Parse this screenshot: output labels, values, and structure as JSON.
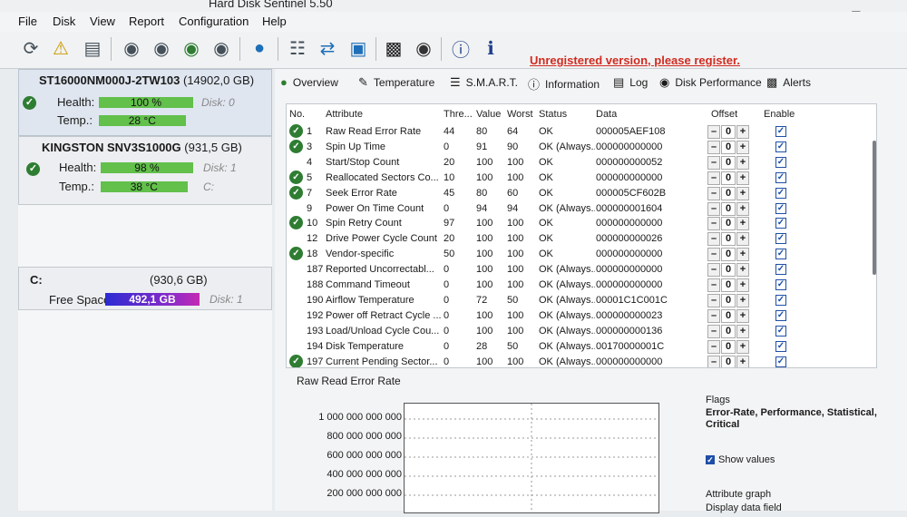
{
  "title": "Hard Disk Sentinel 5.50",
  "menu": [
    "File",
    "Disk",
    "View",
    "Report",
    "Configuration",
    "Help"
  ],
  "unregistered": "Unregistered version, please register.",
  "disks": [
    {
      "name": "ST16000NM000J-2TW103",
      "capacity": "(14902,0 GB)",
      "health_label": "Health:",
      "health": "100 %",
      "health_pct": 100,
      "disk_label": "Disk: 0",
      "temp_label": "Temp.:",
      "temp": "28 °C",
      "temp_pct": 92
    },
    {
      "name": "KINGSTON SNV3S1000G",
      "capacity": "(931,5 GB)",
      "health_label": "Health:",
      "health": "98 %",
      "health_pct": 98,
      "disk_label": "Disk: 1",
      "temp_label": "Temp.:",
      "temp": "38 °C",
      "temp_pct": 92,
      "temp_sub": "C:"
    }
  ],
  "volume": {
    "name": "C:",
    "size": "(930,6 GB)",
    "free_label": "Free Space",
    "free": "492,1 GB",
    "disk": "Disk: 1"
  },
  "tabs": [
    "Overview",
    "Temperature",
    "S.M.A.R.T.",
    "Information",
    "Log",
    "Disk Performance",
    "Alerts"
  ],
  "columns": {
    "no": "No.",
    "attribute": "Attribute",
    "thre": "Thre...",
    "value": "Value",
    "worst": "Worst",
    "status": "Status",
    "data": "Data",
    "offset": "Offset",
    "enable": "Enable"
  },
  "rows": [
    {
      "ok": true,
      "no": "1",
      "attr": "Raw Read Error Rate",
      "thre": "44",
      "value": "80",
      "worst": "64",
      "status": "OK",
      "data": "000005AEF108"
    },
    {
      "ok": true,
      "no": "3",
      "attr": "Spin Up Time",
      "thre": "0",
      "value": "91",
      "worst": "90",
      "status": "OK (Always...",
      "data": "000000000000"
    },
    {
      "ok": false,
      "no": "4",
      "attr": "Start/Stop Count",
      "thre": "20",
      "value": "100",
      "worst": "100",
      "status": "OK",
      "data": "000000000052"
    },
    {
      "ok": true,
      "no": "5",
      "attr": "Reallocated Sectors Co...",
      "thre": "10",
      "value": "100",
      "worst": "100",
      "status": "OK",
      "data": "000000000000"
    },
    {
      "ok": true,
      "no": "7",
      "attr": "Seek Error Rate",
      "thre": "45",
      "value": "80",
      "worst": "60",
      "status": "OK",
      "data": "000005CF602B"
    },
    {
      "ok": false,
      "no": "9",
      "attr": "Power On Time Count",
      "thre": "0",
      "value": "94",
      "worst": "94",
      "status": "OK (Always...",
      "data": "000000001604"
    },
    {
      "ok": true,
      "no": "10",
      "attr": "Spin Retry Count",
      "thre": "97",
      "value": "100",
      "worst": "100",
      "status": "OK",
      "data": "000000000000"
    },
    {
      "ok": false,
      "no": "12",
      "attr": "Drive Power Cycle Count",
      "thre": "20",
      "value": "100",
      "worst": "100",
      "status": "OK",
      "data": "000000000026"
    },
    {
      "ok": true,
      "no": "18",
      "attr": "Vendor-specific",
      "thre": "50",
      "value": "100",
      "worst": "100",
      "status": "OK",
      "data": "000000000000"
    },
    {
      "ok": false,
      "no": "187",
      "attr": "Reported Uncorrectabl...",
      "thre": "0",
      "value": "100",
      "worst": "100",
      "status": "OK (Always...",
      "data": "000000000000"
    },
    {
      "ok": false,
      "no": "188",
      "attr": "Command Timeout",
      "thre": "0",
      "value": "100",
      "worst": "100",
      "status": "OK (Always...",
      "data": "000000000000"
    },
    {
      "ok": false,
      "no": "190",
      "attr": "Airflow Temperature",
      "thre": "0",
      "value": "72",
      "worst": "50",
      "status": "OK (Always...",
      "data": "00001C1C001C"
    },
    {
      "ok": false,
      "no": "192",
      "attr": "Power off Retract Cycle ...",
      "thre": "0",
      "value": "100",
      "worst": "100",
      "status": "OK (Always...",
      "data": "000000000023"
    },
    {
      "ok": false,
      "no": "193",
      "attr": "Load/Unload Cycle Cou...",
      "thre": "0",
      "value": "100",
      "worst": "100",
      "status": "OK (Always...",
      "data": "000000000136"
    },
    {
      "ok": false,
      "no": "194",
      "attr": "Disk Temperature",
      "thre": "0",
      "value": "28",
      "worst": "50",
      "status": "OK (Always...",
      "data": "00170000001C"
    },
    {
      "ok": true,
      "no": "197",
      "attr": "Current Pending Sector...",
      "thre": "0",
      "value": "100",
      "worst": "100",
      "status": "OK (Always...",
      "data": "000000000000"
    }
  ],
  "offset_value": "0",
  "chart": {
    "title": "Raw Read Error Rate",
    "yticks": [
      "1 000 000 000 000",
      "800 000 000 000",
      "600 000 000 000",
      "400 000 000 000",
      "200 000 000 000"
    ]
  },
  "flags_label": "Flags",
  "flags_value": "Error-Rate, Performance, Statistical, Critical",
  "show_values": "Show values",
  "attribute_graph": "Attribute graph",
  "display_data_field": "Display data field"
}
